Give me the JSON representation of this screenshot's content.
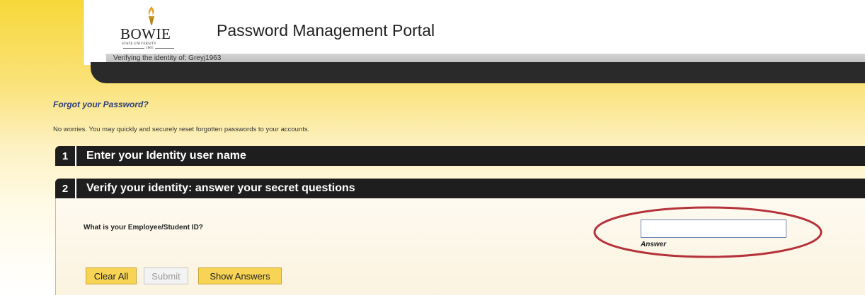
{
  "header": {
    "logo": {
      "wordmark": "BOWIE",
      "subtitle": "STATE UNIVERSITY",
      "year": "1865"
    },
    "title": "Password Management Portal",
    "verify_text": "Verifying the identity of: Greyj1963"
  },
  "intro": {
    "heading": "Forgot your Password?",
    "description": "No worries. You may quickly and securely reset forgotten passwords to your accounts."
  },
  "steps": [
    {
      "number": "1",
      "label": "Enter your Identity user name"
    },
    {
      "number": "2",
      "label": "Verify your identity: answer your secret questions"
    }
  ],
  "question": {
    "text": "What is your Employee/Student ID?",
    "answer_value": "",
    "answer_label": "Answer"
  },
  "buttons": {
    "clear_all": "Clear All",
    "submit": "Submit",
    "show_answers": "Show Answers"
  },
  "colors": {
    "accent_yellow": "#f7d455",
    "dark_bar": "#1e1e1e",
    "highlight_ring": "#b5333a",
    "heading_blue": "#2a3d7a"
  },
  "icons": {
    "logo_torch": "torch-icon"
  }
}
